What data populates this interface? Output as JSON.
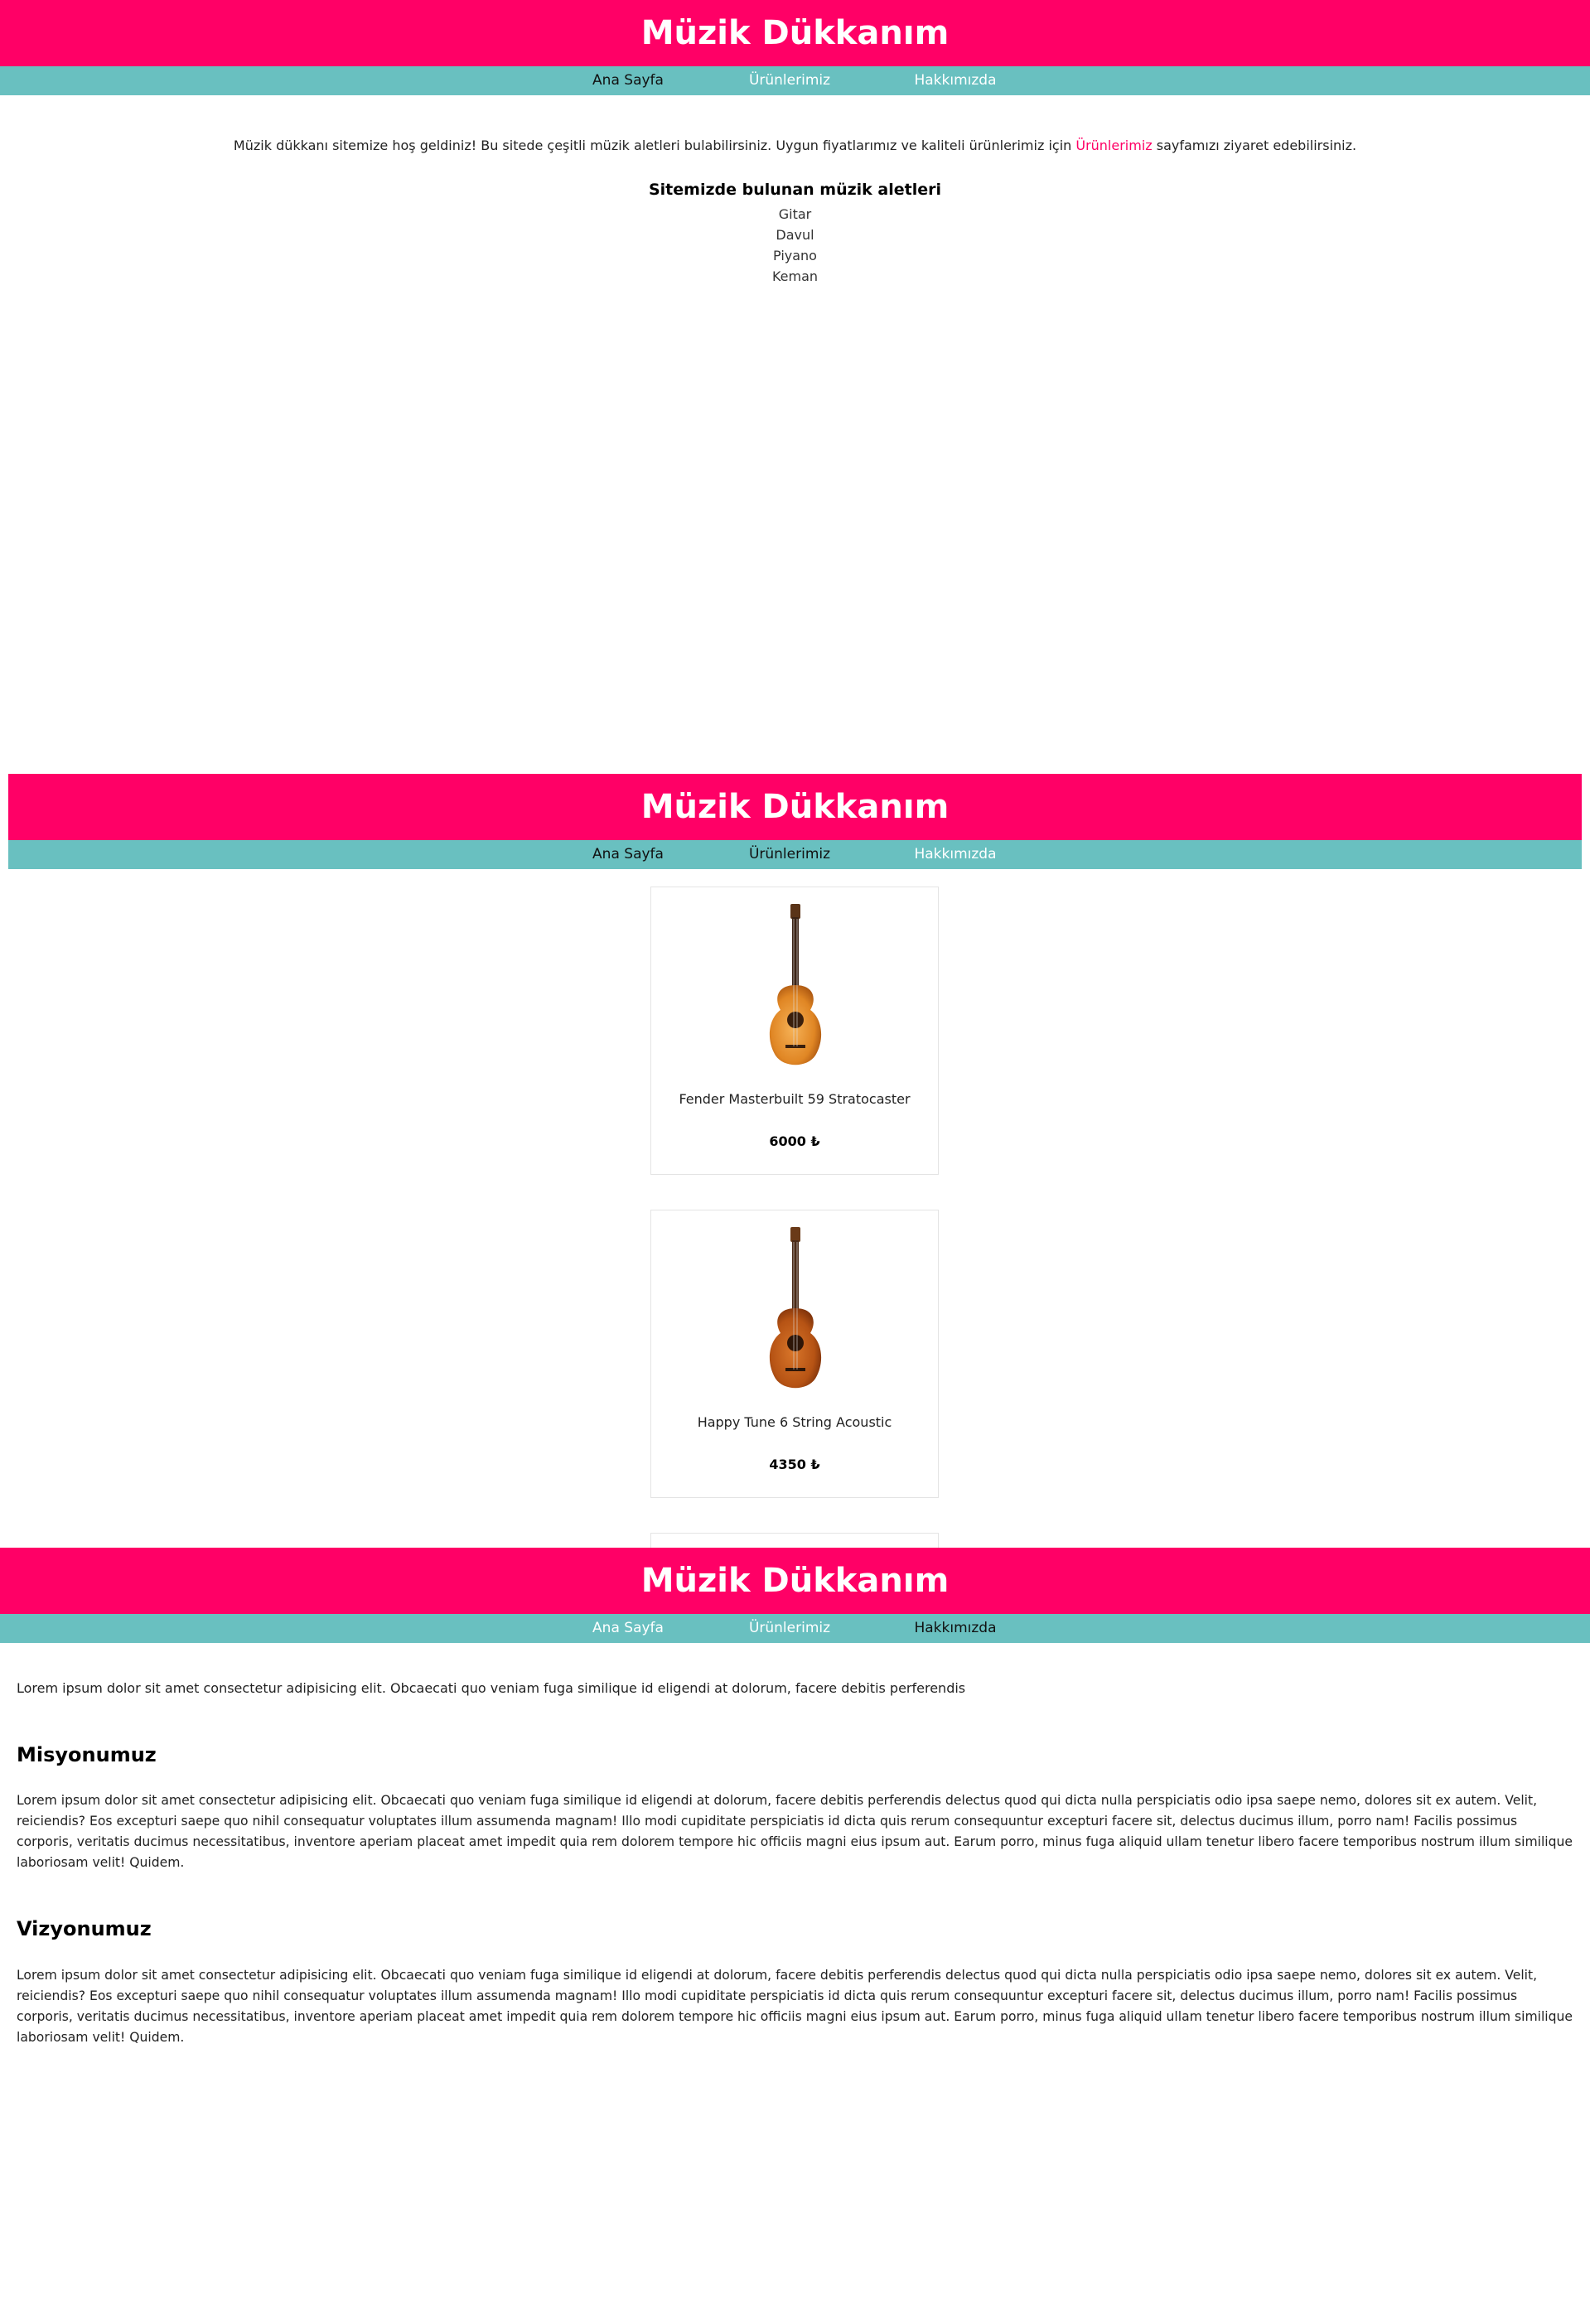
{
  "site": {
    "title": "Müzik Dükkanım",
    "nav": {
      "home": "Ana Sayfa",
      "products": "Ürünlerimiz",
      "about": "Hakkımızda"
    },
    "brand_color": "#ff0066",
    "nav_color": "#69c0c0"
  },
  "home": {
    "welcome_before": "Müzik dükkanı sitemize hoş geldiniz! Bu sitede çeşitli müzik aletleri bulabilirsiniz. Uygun fiyatlarımız ve kaliteli ürünlerimiz için ",
    "welcome_link": "Ürünlerimiz",
    "welcome_after": " sayfamızı ziyaret edebilirsiniz.",
    "instruments_title": "Sitemizde bulunan müzik aletleri",
    "instruments": [
      "Gitar",
      "Davul",
      "Piyano",
      "Keman"
    ]
  },
  "products": {
    "items": [
      {
        "name": "Fender Masterbuilt 59 Stratocaster",
        "price": "6000 ₺",
        "icon": "acoustic-guitar-icon"
      },
      {
        "name": "Happy Tune 6 String Acoustic",
        "price": "4350 ₺",
        "icon": "acoustic-guitar-icon"
      }
    ]
  },
  "about": {
    "intro": "Lorem ipsum dolor sit amet consectetur adipisicing elit. Obcaecati quo veniam fuga similique id eligendi at dolorum, facere debitis perferendis",
    "mission_title": "Misyonumuz",
    "mission_text": "Lorem ipsum dolor sit amet consectetur adipisicing elit. Obcaecati quo veniam fuga similique id eligendi at dolorum, facere debitis perferendis delectus quod qui dicta nulla perspiciatis odio ipsa saepe nemo, dolores sit ex autem. Velit, reiciendis? Eos excepturi saepe quo nihil consequatur voluptates illum assumenda magnam! Illo modi cupiditate perspiciatis id dicta quis rerum consequuntur excepturi facere sit, delectus ducimus illum, porro nam! Facilis possimus corporis, veritatis ducimus necessitatibus, inventore aperiam placeat amet impedit quia rem dolorem tempore hic officiis magni eius ipsum aut. Earum porro, minus fuga aliquid ullam tenetur libero facere temporibus nostrum illum similique laboriosam velit! Quidem.",
    "vision_title": "Vizyonumuz",
    "vision_text": "Lorem ipsum dolor sit amet consectetur adipisicing elit. Obcaecati quo veniam fuga similique id eligendi at dolorum, facere debitis perferendis delectus quod qui dicta nulla perspiciatis odio ipsa saepe nemo, dolores sit ex autem. Velit, reiciendis? Eos excepturi saepe quo nihil consequatur voluptates illum assumenda magnam! Illo modi cupiditate perspiciatis id dicta quis rerum consequuntur excepturi facere sit, delectus ducimus illum, porro nam! Facilis possimus corporis, veritatis ducimus necessitatibus, inventore aperiam placeat amet impedit quia rem dolorem tempore hic officiis magni eius ipsum aut. Earum porro, minus fuga aliquid ullam tenetur libero facere temporibus nostrum illum similique laboriosam velit! Quidem."
  }
}
